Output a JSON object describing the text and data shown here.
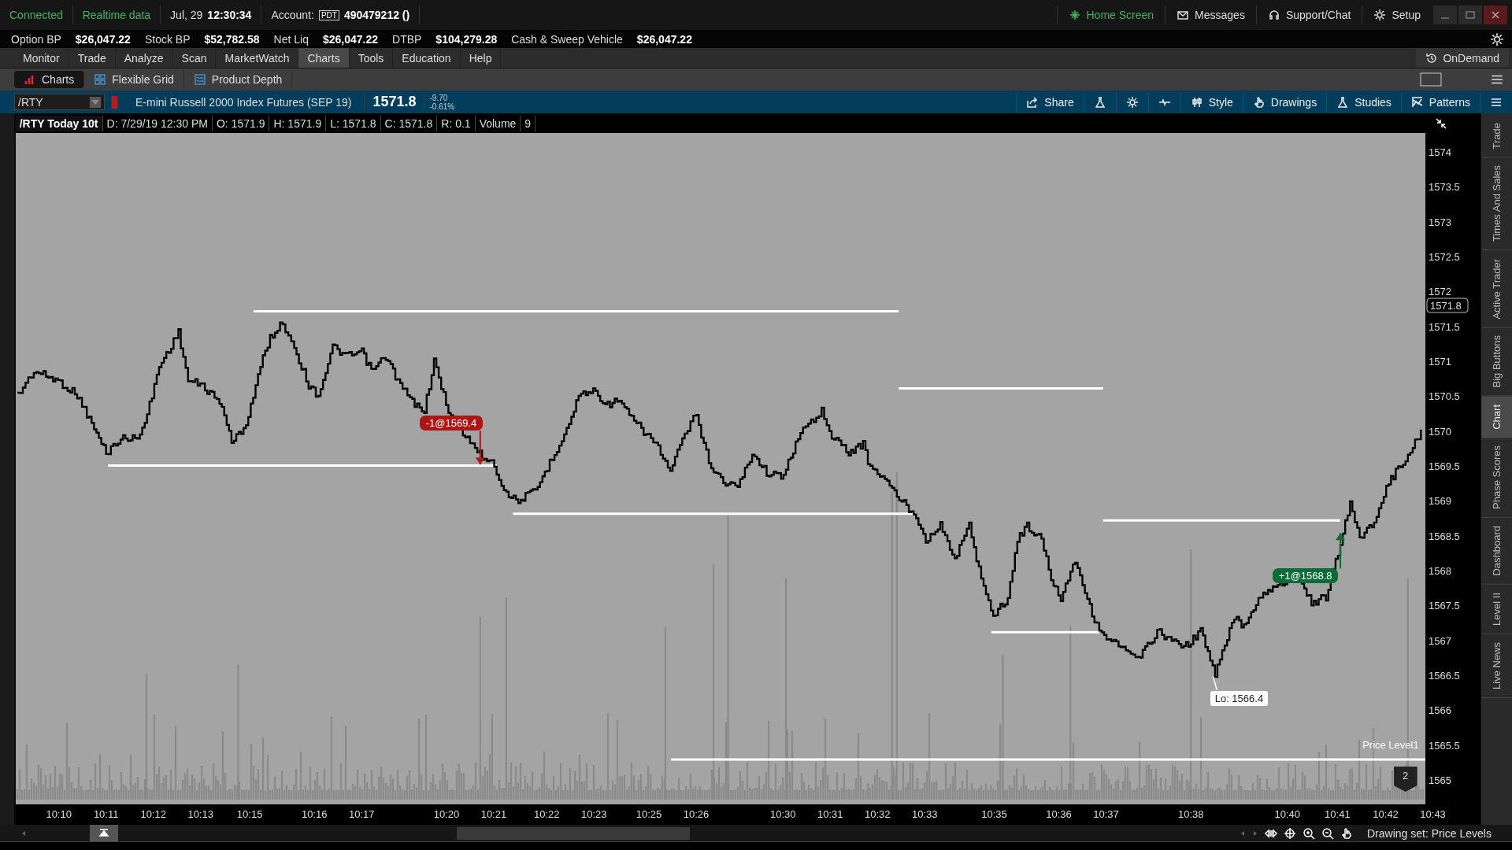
{
  "status_bar": {
    "connection": "Connected",
    "data_feed": "Realtime data",
    "date": "Jul, 29",
    "time": "12:30:34",
    "account_label": "Account:",
    "account_badge": "PDT",
    "account_number": "490479212 ()"
  },
  "top_links": [
    {
      "label": "Home Screen",
      "kind": "home"
    },
    {
      "label": "Messages",
      "kind": "mail"
    },
    {
      "label": "Support/Chat",
      "kind": "headset"
    },
    {
      "label": "Setup",
      "kind": "gear"
    }
  ],
  "balances": [
    {
      "label": "Option BP",
      "value": "$26,047.22"
    },
    {
      "label": "Stock BP",
      "value": "$52,782.58"
    },
    {
      "label": "Net Liq",
      "value": "$26,047.22"
    },
    {
      "label": "DTBP",
      "value": "$104,279.28"
    },
    {
      "label": "Cash & Sweep Vehicle",
      "value": "$26,047.22"
    }
  ],
  "menu": [
    {
      "label": "Monitor",
      "selected": false
    },
    {
      "label": "Trade",
      "selected": false
    },
    {
      "label": "Analyze",
      "selected": false
    },
    {
      "label": "Scan",
      "selected": false
    },
    {
      "label": "MarketWatch",
      "selected": false
    },
    {
      "label": "Charts",
      "selected": true
    },
    {
      "label": "Tools",
      "selected": false
    },
    {
      "label": "Education",
      "selected": false
    },
    {
      "label": "Help",
      "selected": false
    }
  ],
  "on_demand": "OnDemand",
  "subtabs": [
    {
      "label": "Charts",
      "selected": true,
      "kind": "bars"
    },
    {
      "label": "Flexible Grid",
      "selected": false,
      "kind": "grid"
    },
    {
      "label": "Product Depth",
      "selected": false,
      "kind": "depth"
    }
  ],
  "symbol_bar": {
    "symbol": "/RTY",
    "description": "E-mini Russell 2000 Index Futures (SEP 19)",
    "last": "1571.8",
    "change": "-9.70",
    "change_pct": "-0.61%"
  },
  "chart_tools": [
    {
      "label": "Share",
      "kind": "share"
    },
    {
      "kind": "flask"
    },
    {
      "kind": "gear"
    },
    {
      "kind": "pulse"
    },
    {
      "label": "Style",
      "kind": "candles"
    },
    {
      "label": "Drawings",
      "kind": "hand"
    },
    {
      "label": "Studies",
      "kind": "flask"
    },
    {
      "label": "Patterns",
      "kind": "pattern"
    },
    {
      "kind": "list"
    }
  ],
  "info_bar": [
    "/RTY Today 10t",
    "D: 7/29/19 12:30 PM",
    "O: 1571.9",
    "H: 1571.9",
    "L: 1571.8",
    "C: 1571.8",
    "R: 0.1",
    "Volume",
    "9"
  ],
  "price_axis": [
    "1574",
    "1573.5",
    "1573",
    "1572.5",
    "1572",
    "1571.5",
    "1571",
    "1570.5",
    "1570",
    "1569.5",
    "1569",
    "1568.5",
    "1568",
    "1567.5",
    "1567",
    "1566.5",
    "1566",
    "1565.5",
    "1565"
  ],
  "current_price_tag": "1571.8",
  "time_axis": [
    "10:10",
    "10:11",
    "10:12",
    "10:13",
    "10:15",
    "10:16",
    "10:17",
    "10:20",
    "10:21",
    "10:22",
    "10:23",
    "10:25",
    "10:26",
    "10:30",
    "10:31",
    "10:32",
    "10:33",
    "10:35",
    "10:36",
    "10:37",
    "10:38",
    "10:40",
    "10:41",
    "10:42",
    "10:43"
  ],
  "trades": [
    {
      "label": "-1@1569.4",
      "kind": "sell"
    },
    {
      "label": "+1@1568.8",
      "kind": "buy"
    }
  ],
  "low_label": "Lo: 1566.4",
  "price_level_label": "Price Level1",
  "drawing_count": "2",
  "side_tabs": [
    {
      "label": "Trade",
      "selected": false
    },
    {
      "label": "Times And Sales",
      "selected": false
    },
    {
      "label": "Active Trader",
      "selected": false
    },
    {
      "label": "Big Buttons",
      "selected": false
    },
    {
      "label": "Chart",
      "selected": true
    },
    {
      "label": "Phase Scores",
      "selected": false
    },
    {
      "label": "Dashboard",
      "selected": false
    },
    {
      "label": "Level II",
      "selected": false
    },
    {
      "label": "Live News",
      "selected": false
    }
  ],
  "drawing_set": "Drawing set: Price Levels"
}
